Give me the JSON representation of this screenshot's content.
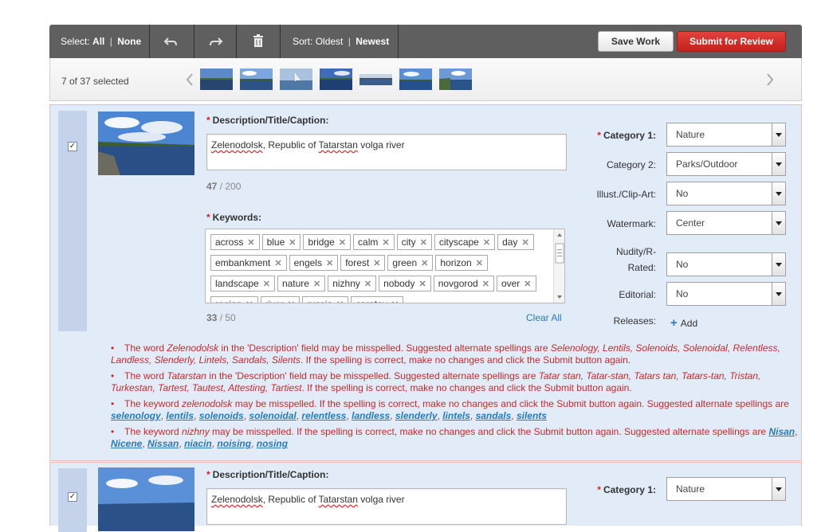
{
  "toolbar": {
    "select_label": "Select:",
    "select_all": "All",
    "select_none": "None",
    "sort_label": "Sort:",
    "sort_oldest": "Oldest",
    "sort_newest": "Newest",
    "save_label": "Save Work",
    "submit_label": "Submit for Review",
    "icons": [
      "undo-icon",
      "redo-icon",
      "trash-icon"
    ]
  },
  "filmstrip": {
    "selected_text": "7 of 37 selected",
    "thumbnail_count": 7
  },
  "items": [
    {
      "checked": "✓",
      "description_label": "Description/Title/Caption:",
      "description_value": "Zelenodolsk, Republic of Tatarstan volga river",
      "description_count": "47",
      "description_max": "/ 200",
      "keywords_label": "Keywords:",
      "keywords": [
        "across",
        "blue",
        "bridge",
        "calm",
        "city",
        "cityscape",
        "day",
        "embankment",
        "engels",
        "forest",
        "green",
        "horizon",
        "landscape",
        "nature",
        "nizhny",
        "nobody",
        "novgorod",
        "over",
        "region",
        "river",
        "russia",
        "saratov"
      ],
      "keywords_count": "33",
      "keywords_max": "/ 50",
      "clear_all": "Clear All",
      "fields": [
        {
          "label": "Category 1:",
          "value": "Nature",
          "required": true
        },
        {
          "label": "Category 2:",
          "value": "Parks/Outdoor",
          "required": false
        },
        {
          "label": "Illust./Clip-Art:",
          "value": "No",
          "required": false
        },
        {
          "label": "Watermark:",
          "value": "Center",
          "required": false
        },
        {
          "label_line1": "Nudity/R-",
          "label_line2": "Rated:",
          "value": "No",
          "required": false
        },
        {
          "label": "Editorial:",
          "value": "No",
          "required": false
        }
      ],
      "releases_label": "Releases:",
      "add_label": "Add",
      "warnings": {
        "w1": {
          "pre": "The word ",
          "word": "Zelenodolsk",
          "mid": " in the 'Description' field may be misspelled. Suggested alternate spellings are ",
          "suggestions": "Selenology, Lentils, Solenoids, Solenoidal, Relentless, Landless, Slenderly, Lintels, Sandals, Silents",
          "post": ". If the spelling is correct, make no changes and click the Submit button again."
        },
        "w2": {
          "pre": "The word ",
          "word": "Tatarstan",
          "mid": " in the 'Description' field may be misspelled. Suggested alternate spellings are ",
          "suggestions": "Tatar stan, Tatar-stan, Tatars tan, Tatars-tan, Tristan, Turkestan, Tartest, Tautest, Attesting, Tartiest",
          "post": ". If the spelling is correct, make no changes and click the Submit button again."
        },
        "w3": {
          "pre": "The keyword ",
          "word": "zelenodolsk",
          "mid": " may be misspelled. If the spelling is correct, make no changes and click the Submit button again. Suggested alternate spellings are ",
          "links": [
            "selenology",
            "lentils",
            "solenoids",
            "solenoidal",
            "relentless",
            "landless",
            "slenderly",
            "lintels",
            "sandals",
            "silents"
          ]
        },
        "w4": {
          "pre": "The keyword ",
          "word": "nizhny",
          "mid": " may be misspelled. If the spelling is correct, make no changes and click the Submit button again. Suggested alternate spellings are ",
          "links": [
            "Nisan",
            "Nicene",
            "Nissan",
            "niacin",
            "noising",
            "nosing"
          ]
        }
      }
    },
    {
      "checked": "✓",
      "description_label": "Description/Title/Caption:",
      "description_value": "Zelenodolsk, Republic of Tatarstan volga river",
      "category1_label": "Category 1:",
      "category1_value": "Nature"
    }
  ],
  "colors": {
    "toolbar": "#5f5f5f",
    "submit": "#d12d28",
    "panel": "#e2ebf8",
    "warning": "#c52a2a",
    "link": "#2a79b8"
  }
}
